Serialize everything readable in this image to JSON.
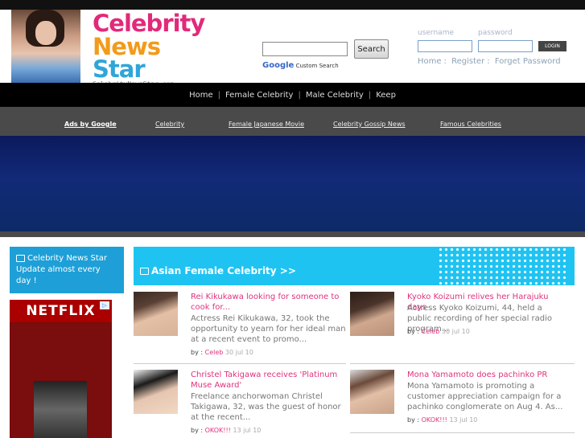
{
  "logo": {
    "line1": "Celebrity",
    "line2": "News",
    "line3": "Star",
    "domain": "CelebrityNewsStar.com"
  },
  "search": {
    "button": "Search",
    "google": "Google",
    "custom": "Custom Search"
  },
  "account": {
    "username_label": "username",
    "password_label": "password",
    "login": "LOGIN",
    "home": "Home",
    "register": "Register",
    "forget": "Forget Password",
    "sep": ":"
  },
  "nav": {
    "items": [
      "Home",
      "Female Celebrity",
      "Male Celebrity",
      "Keep"
    ],
    "sep": "|"
  },
  "ads": {
    "items": [
      "Ads by Google",
      "Celebrity",
      "Female Japanese Movie",
      "Celebrity Gossip News",
      "Famous Celebrities"
    ]
  },
  "sidebar": {
    "update": "Celebrity News Star Update almost every day !",
    "ad_brand": "NETFLIX"
  },
  "section": {
    "title": "Asian Female Celebrity >>"
  },
  "articles": [
    {
      "title": "Rei Kikukawa looking for someone to cook for...",
      "excerpt": "Actress Rei Kikukawa, 32, took the opportunity to yearn for her ideal man at a recent event to promo...",
      "by": "by :",
      "author": "Celeb",
      "date": "30 jul 10"
    },
    {
      "title": "Kyoko Koizumi relives her Harajuku days",
      "excerpt": "Actress Kyoko Koizumi, 44, held a public recording of her special radio program...",
      "by": "by :",
      "author": "Celeb",
      "date": "30 jul 10"
    },
    {
      "title": "Christel Takigawa receives 'Platinum Muse Award'",
      "excerpt": "Freelance anchorwoman Christel Takigawa, 32, was the guest of honor at the recent...",
      "by": "by :",
      "author": "OKOK!!!",
      "date": "13 jul 10"
    },
    {
      "title": "Mona Yamamoto does pachinko PR",
      "excerpt": "Mona Yamamoto is promoting a customer appreciation campaign for a pachinko conglomerate on Aug 4. As...",
      "by": "by :",
      "author": "OKOK!!!",
      "date": "13 jul 10"
    }
  ]
}
